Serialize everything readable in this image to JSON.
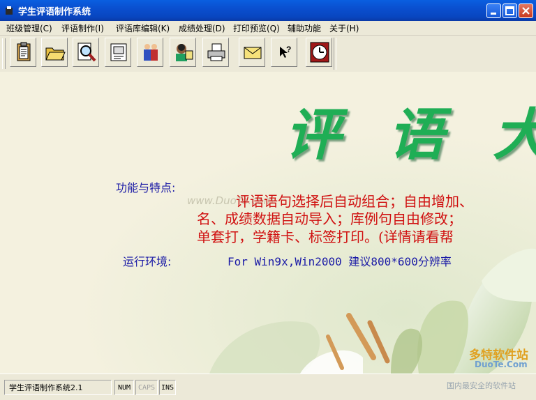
{
  "window": {
    "title": "学生评语制作系统"
  },
  "menu": [
    "班级管理(C)",
    "评语制作(I)",
    "评语库编辑(K)",
    "成绩处理(D)",
    "打印预览(Q)",
    "辅助功能",
    "关于(H)"
  ],
  "toolbar": [
    "clipboard-icon",
    "open-folder-icon",
    "magnifier-icon",
    "score-sheet-icon",
    "students-icon",
    "teacher-icon",
    "printer-icon",
    "envelope-icon",
    "help-cursor-icon",
    "clock-icon"
  ],
  "main": {
    "banner": [
      "评",
      "语",
      "大"
    ],
    "features_label": "功能与特点:",
    "features_lines": [
      "评语语句选择后自动组合；自由增加、",
      "名、成绩数据自动导入；库例句自由修改；",
      "单套打，学籍卡、标签打印。(详情请看帮"
    ],
    "env_label": "运行环境:",
    "env_value": "For Win9x,Win2000 建议800*600分辨率",
    "url_watermark": "www.DuoTe.com",
    "brand_watermark": "多特软件站",
    "brand_domain": "DuoTe.Com",
    "brand_slogan": "国内最安全的软件站"
  },
  "status": {
    "text": "学生评语制作系统2.1",
    "num": "NUM",
    "caps": "CAPS",
    "ins": "INS"
  }
}
